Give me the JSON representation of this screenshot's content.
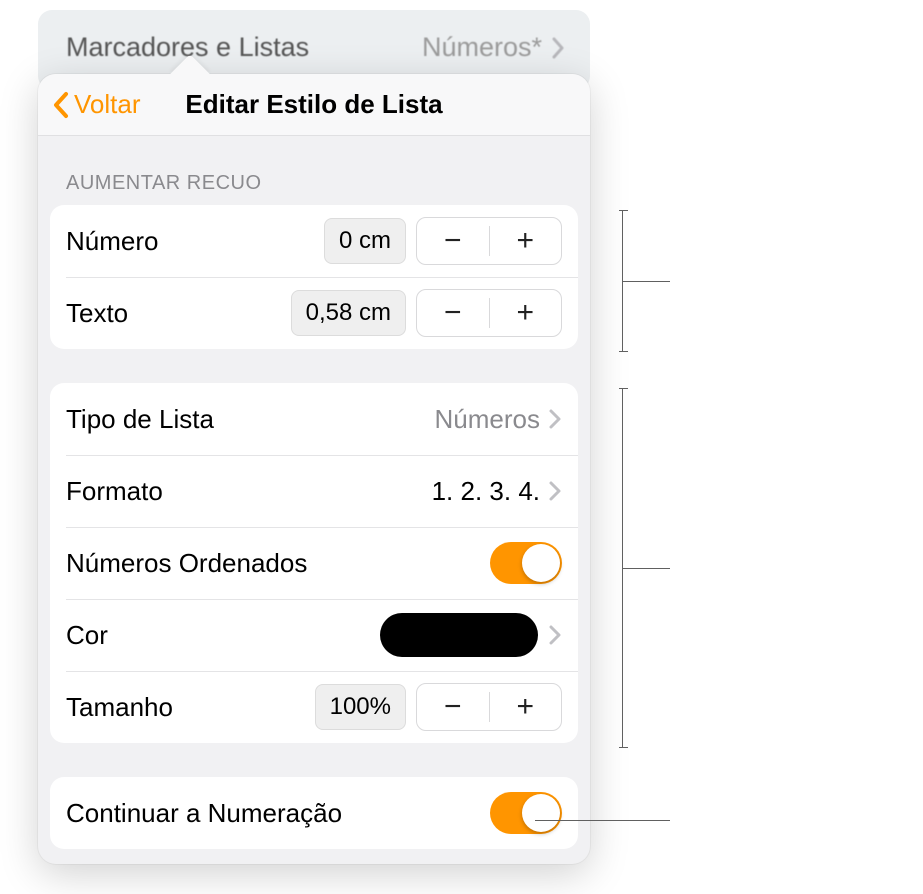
{
  "colors": {
    "accent": "#ff9500",
    "swatch": "#000000"
  },
  "back_panel": {
    "label": "Marcadores e Listas",
    "value": "Números*"
  },
  "header": {
    "back_label": "Voltar",
    "title": "Editar Estilo de Lista"
  },
  "indent_section": {
    "header": "Aumentar Recuo",
    "number": {
      "label": "Número",
      "value": "0 cm"
    },
    "text": {
      "label": "Texto",
      "value": "0,58 cm"
    }
  },
  "list_section": {
    "type": {
      "label": "Tipo de Lista",
      "value": "Números"
    },
    "format": {
      "label": "Formato",
      "value": "1. 2. 3. 4."
    },
    "ordered": {
      "label": "Números Ordenados",
      "on": true
    },
    "color": {
      "label": "Cor"
    },
    "size": {
      "label": "Tamanho",
      "value": "100%"
    }
  },
  "continue_section": {
    "label": "Continuar a Numeração",
    "on": true
  }
}
